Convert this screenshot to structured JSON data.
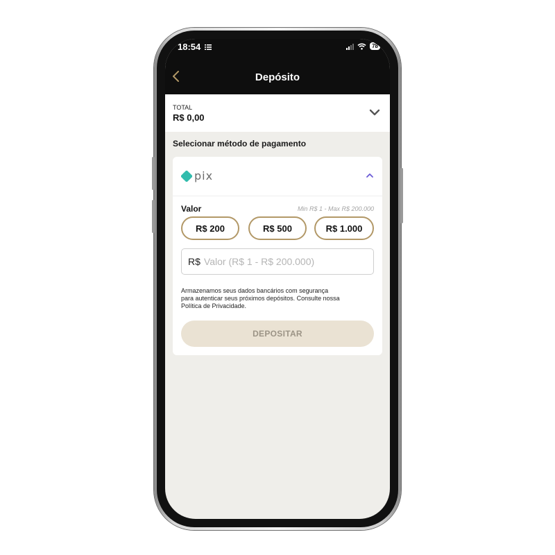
{
  "status_bar": {
    "time": "18:54",
    "battery": "78"
  },
  "header": {
    "title": "Depósito"
  },
  "total": {
    "label": "TOTAL",
    "value": "R$ 0,00"
  },
  "payment_section": {
    "title": "Selecionar método de pagamento"
  },
  "payment_method": {
    "name": "pix",
    "valor_label": "Valor",
    "limits": "Min R$ 1 - Max R$ 200.000",
    "quick_amounts": [
      "R$ 200",
      "R$ 500",
      "R$ 1.000"
    ],
    "currency_prefix": "R$",
    "input_placeholder": "Valor (R$ 1 - R$ 200.000)",
    "notice_lines": [
      "Armazenamos seus dados bancários com segurança",
      "para autenticar seus próximos depósitos. Consulte nossa",
      "Política de Privacidade."
    ],
    "submit_label": "DEPOSITAR"
  },
  "colors": {
    "accent_gold": "#b29867",
    "pix_teal": "#32bcad",
    "header_bg": "#0e0e0e",
    "page_bg": "#efeeea",
    "disabled_button_bg": "#eae2d3"
  },
  "icons": [
    "back-chevron-icon",
    "chevron-down-icon",
    "chevron-up-icon",
    "pix-logo-icon",
    "wifi-icon",
    "signal-icon",
    "battery-icon",
    "list-icon"
  ]
}
